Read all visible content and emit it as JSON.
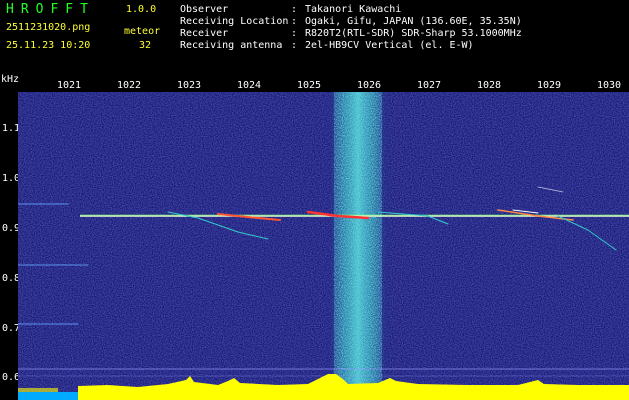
{
  "header": {
    "brand": "HROFFT",
    "version": "1.0.0",
    "filename": "2511231020.png",
    "timestamp": "25.11.23 10:20",
    "meteor_label": "meteor",
    "meteor_count": "32"
  },
  "station_info": [
    {
      "label": "Observer",
      "value": "Takanori Kawachi"
    },
    {
      "label": "Receiving Location",
      "value": "Ogaki, Gifu, JAPAN (136.60E, 35.35N)"
    },
    {
      "label": "Receiver",
      "value": "R820T2(RTL-SDR) SDR-Sharp 53.1000MHz"
    },
    {
      "label": "Receiving antenna",
      "value": "2el-HB9CV Vertical (el. E-W)"
    }
  ],
  "axes": {
    "y_unit": "kHz",
    "x_ticks": [
      "1021",
      "1022",
      "1023",
      "1024",
      "1025",
      "1026",
      "1027",
      "1028",
      "1029",
      "1030"
    ],
    "y_ticks": [
      "1.1",
      "1.0",
      "0.9",
      "0.8",
      "0.7",
      "0.6"
    ]
  },
  "colors": {
    "background_noise": "#1a1a80",
    "carrier_line": "#ffffff",
    "noise_band": "#33cccc",
    "meteor_head": "#ff3333",
    "signal_bar": "#ffff00",
    "text_green": "#22ff22",
    "text_yellow": "#ffff33"
  }
}
